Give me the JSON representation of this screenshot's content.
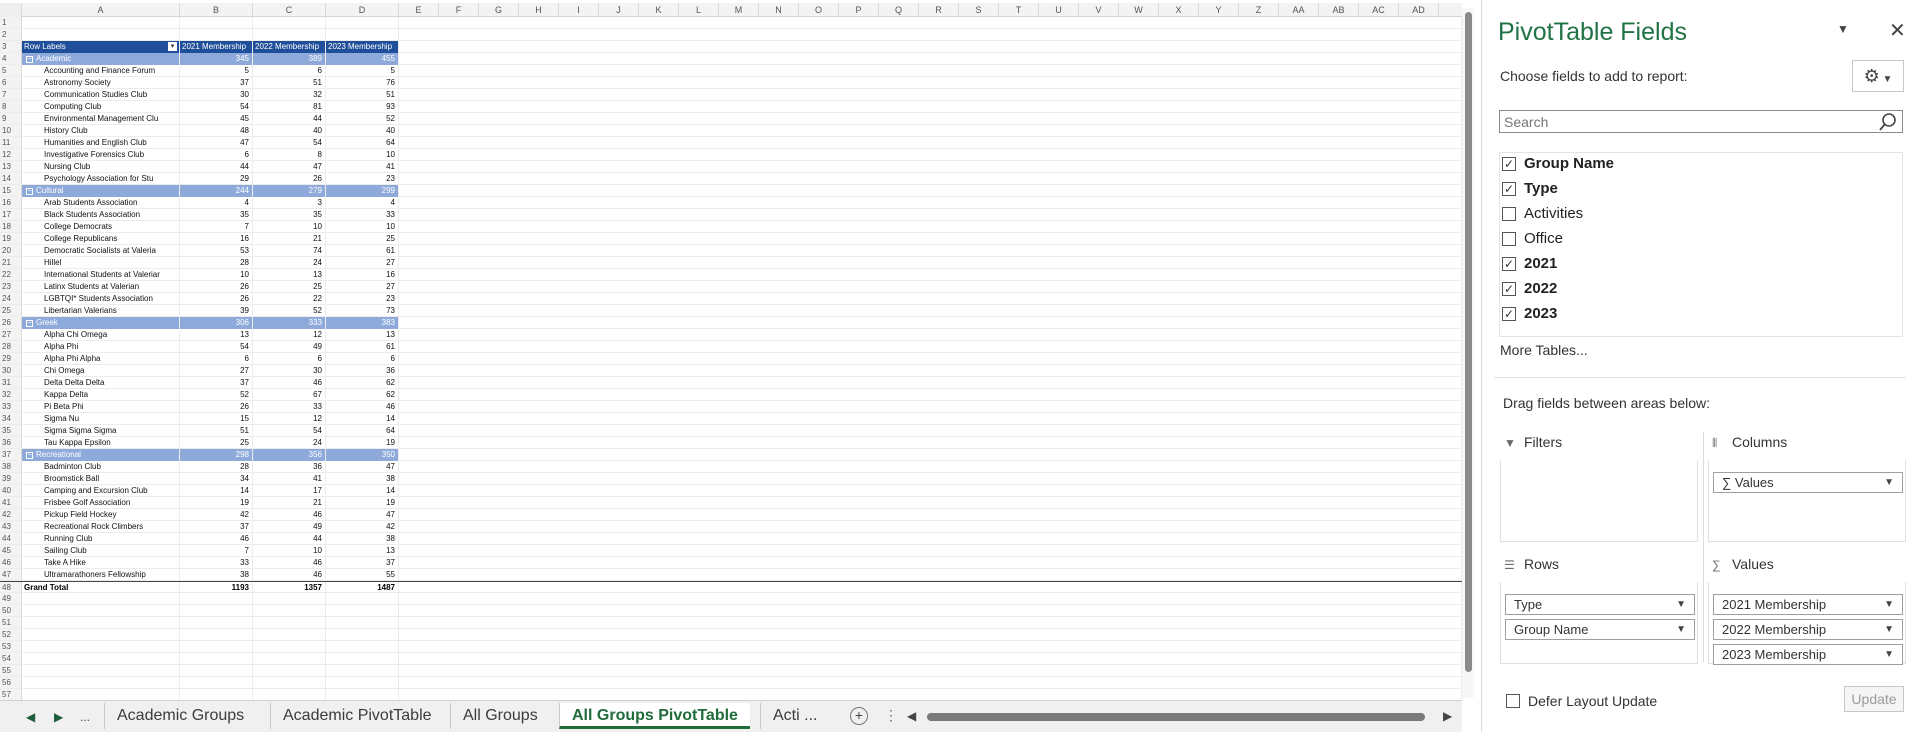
{
  "sheet": {
    "columns": [
      "A",
      "B",
      "C",
      "D",
      "E",
      "F",
      "G",
      "H",
      "I",
      "J",
      "K",
      "L",
      "M",
      "N",
      "O",
      "P",
      "Q",
      "R",
      "S",
      "T",
      "U",
      "V",
      "W",
      "X",
      "Y",
      "Z",
      "AA",
      "AB",
      "AC",
      "AD"
    ],
    "header_row": {
      "row_labels": "Row Labels",
      "b": "2021 Membership",
      "c": "2022 Membership",
      "d": "2023 Membership"
    },
    "rows": [
      {
        "n": "1",
        "type": "empty"
      },
      {
        "n": "2",
        "type": "empty"
      },
      {
        "n": "3",
        "type": "hdr"
      },
      {
        "n": "4",
        "type": "grp",
        "label": "Academic",
        "b": "345",
        "c": "389",
        "d": "455"
      },
      {
        "n": "5",
        "type": "item",
        "label": "Accounting and Finance Forum",
        "b": "5",
        "c": "6",
        "d": "5"
      },
      {
        "n": "6",
        "type": "item",
        "label": "Astronomy Society",
        "b": "37",
        "c": "51",
        "d": "76"
      },
      {
        "n": "7",
        "type": "item",
        "label": "Communication Studies Club",
        "b": "30",
        "c": "32",
        "d": "51"
      },
      {
        "n": "8",
        "type": "item",
        "label": "Computing Club",
        "b": "54",
        "c": "81",
        "d": "93"
      },
      {
        "n": "9",
        "type": "item",
        "label": "Environmental Management Clu",
        "b": "45",
        "c": "44",
        "d": "52"
      },
      {
        "n": "10",
        "type": "item",
        "label": "History Club",
        "b": "48",
        "c": "40",
        "d": "40"
      },
      {
        "n": "11",
        "type": "item",
        "label": "Humanities and English Club",
        "b": "47",
        "c": "54",
        "d": "64"
      },
      {
        "n": "12",
        "type": "item",
        "label": "Investigative Forensics Club",
        "b": "6",
        "c": "8",
        "d": "10"
      },
      {
        "n": "13",
        "type": "item",
        "label": "Nursing Club",
        "b": "44",
        "c": "47",
        "d": "41"
      },
      {
        "n": "14",
        "type": "item",
        "label": "Psychology Association for Stu",
        "b": "29",
        "c": "26",
        "d": "23"
      },
      {
        "n": "15",
        "type": "grp",
        "label": "Cultural",
        "b": "244",
        "c": "279",
        "d": "299"
      },
      {
        "n": "16",
        "type": "item",
        "label": "Arab Students Association",
        "b": "4",
        "c": "3",
        "d": "4"
      },
      {
        "n": "17",
        "type": "item",
        "label": "Black Students Association",
        "b": "35",
        "c": "35",
        "d": "33"
      },
      {
        "n": "18",
        "type": "item",
        "label": "College Democrats",
        "b": "7",
        "c": "10",
        "d": "10"
      },
      {
        "n": "19",
        "type": "item",
        "label": "College Republicans",
        "b": "16",
        "c": "21",
        "d": "25"
      },
      {
        "n": "20",
        "type": "item",
        "label": "Democratic Socialists at Valeria",
        "b": "53",
        "c": "74",
        "d": "61"
      },
      {
        "n": "21",
        "type": "item",
        "label": "Hillel",
        "b": "28",
        "c": "24",
        "d": "27"
      },
      {
        "n": "22",
        "type": "item",
        "label": "International Students at Valeriar",
        "b": "10",
        "c": "13",
        "d": "16"
      },
      {
        "n": "23",
        "type": "item",
        "label": "Latinx Students at Valerian",
        "b": "26",
        "c": "25",
        "d": "27"
      },
      {
        "n": "24",
        "type": "item",
        "label": "LGBTQI* Students Association",
        "b": "26",
        "c": "22",
        "d": "23"
      },
      {
        "n": "25",
        "type": "item",
        "label": "Libertarian Valerians",
        "b": "39",
        "c": "52",
        "d": "73"
      },
      {
        "n": "26",
        "type": "grp",
        "label": "Greek",
        "b": "306",
        "c": "333",
        "d": "383"
      },
      {
        "n": "27",
        "type": "item",
        "label": "Alpha Chi Omega",
        "b": "13",
        "c": "12",
        "d": "13"
      },
      {
        "n": "28",
        "type": "item",
        "label": "Alpha Phi",
        "b": "54",
        "c": "49",
        "d": "61"
      },
      {
        "n": "29",
        "type": "item",
        "label": "Alpha Phi Alpha",
        "b": "6",
        "c": "6",
        "d": "6"
      },
      {
        "n": "30",
        "type": "item",
        "label": "Chi Omega",
        "b": "27",
        "c": "30",
        "d": "36"
      },
      {
        "n": "31",
        "type": "item",
        "label": "Delta Delta Delta",
        "b": "37",
        "c": "46",
        "d": "62"
      },
      {
        "n": "32",
        "type": "item",
        "label": "Kappa Delta",
        "b": "52",
        "c": "67",
        "d": "62"
      },
      {
        "n": "33",
        "type": "item",
        "label": "Pi Beta Phi",
        "b": "26",
        "c": "33",
        "d": "46"
      },
      {
        "n": "34",
        "type": "item",
        "label": "Sigma Nu",
        "b": "15",
        "c": "12",
        "d": "14"
      },
      {
        "n": "35",
        "type": "item",
        "label": "Sigma Sigma Sigma",
        "b": "51",
        "c": "54",
        "d": "64"
      },
      {
        "n": "36",
        "type": "item",
        "label": "Tau Kappa Epsilon",
        "b": "25",
        "c": "24",
        "d": "19"
      },
      {
        "n": "37",
        "type": "grp",
        "label": "Recreational",
        "b": "298",
        "c": "356",
        "d": "350"
      },
      {
        "n": "38",
        "type": "item",
        "label": "Badminton Club",
        "b": "28",
        "c": "36",
        "d": "47"
      },
      {
        "n": "39",
        "type": "item",
        "label": "Broomstick Ball",
        "b": "34",
        "c": "41",
        "d": "38"
      },
      {
        "n": "40",
        "type": "item",
        "label": "Camping and Excursion Club",
        "b": "14",
        "c": "17",
        "d": "14"
      },
      {
        "n": "41",
        "type": "item",
        "label": "Frisbee Golf Association",
        "b": "19",
        "c": "21",
        "d": "19"
      },
      {
        "n": "42",
        "type": "item",
        "label": "Pickup Field Hockey",
        "b": "42",
        "c": "46",
        "d": "47"
      },
      {
        "n": "43",
        "type": "item",
        "label": "Recreational Rock Climbers",
        "b": "37",
        "c": "49",
        "d": "42"
      },
      {
        "n": "44",
        "type": "item",
        "label": "Running Club",
        "b": "46",
        "c": "44",
        "d": "38"
      },
      {
        "n": "45",
        "type": "item",
        "label": "Sailing Club",
        "b": "7",
        "c": "10",
        "d": "13"
      },
      {
        "n": "46",
        "type": "item",
        "label": "Take A Hike",
        "b": "33",
        "c": "46",
        "d": "37"
      },
      {
        "n": "47",
        "type": "item",
        "label": "Ultramarathoners Fellowship",
        "b": "38",
        "c": "46",
        "d": "55"
      },
      {
        "n": "48",
        "type": "total",
        "label": "Grand Total",
        "b": "1193",
        "c": "1357",
        "d": "1487"
      },
      {
        "n": "49",
        "type": "empty"
      },
      {
        "n": "50",
        "type": "empty"
      },
      {
        "n": "51",
        "type": "empty"
      },
      {
        "n": "52",
        "type": "empty"
      },
      {
        "n": "53",
        "type": "empty"
      },
      {
        "n": "54",
        "type": "empty"
      },
      {
        "n": "55",
        "type": "empty"
      },
      {
        "n": "56",
        "type": "empty"
      },
      {
        "n": "57",
        "type": "empty"
      }
    ]
  },
  "tabs": {
    "more": "...",
    "items": [
      {
        "label": "Academic Groups",
        "active": false
      },
      {
        "label": "Academic PivotTable",
        "active": false
      },
      {
        "label": "All Groups",
        "active": false
      },
      {
        "label": "All Groups PivotTable",
        "active": true
      },
      {
        "label": "Acti ...",
        "active": false
      }
    ],
    "add": "+",
    "menu": "⋮"
  },
  "pane": {
    "title": "PivotTable Fields",
    "choose_label": "Choose fields to add to report:",
    "search_placeholder": "Search",
    "fields": [
      {
        "label": "Group Name",
        "checked": true
      },
      {
        "label": "Type",
        "checked": true
      },
      {
        "label": "Activities",
        "checked": false
      },
      {
        "label": "Office",
        "checked": false
      },
      {
        "label": "2021",
        "checked": true
      },
      {
        "label": "2022",
        "checked": true
      },
      {
        "label": "2023",
        "checked": true
      }
    ],
    "more_tables": "More Tables...",
    "drag_label": "Drag fields between areas below:",
    "areas": {
      "filters": {
        "title": "Filters",
        "icon": "filter-icon",
        "items": []
      },
      "columns": {
        "title": "Columns",
        "icon": "columns-icon",
        "items": [
          "∑ Values"
        ]
      },
      "rows": {
        "title": "Rows",
        "icon": "rows-icon",
        "items": [
          "Type",
          "Group Name"
        ]
      },
      "values": {
        "title": "Values",
        "icon": "sigma-icon",
        "items": [
          "2021 Membership",
          "2022 Membership",
          "2023 Membership"
        ]
      }
    },
    "defer_label": "Defer Layout Update",
    "update_label": "Update"
  }
}
